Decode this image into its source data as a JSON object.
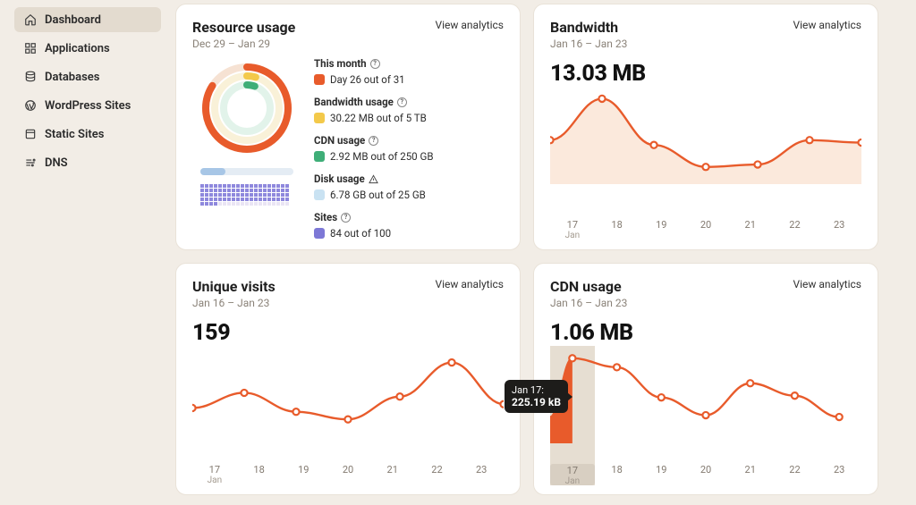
{
  "colors": {
    "accent": "#e85b2b",
    "fill": "#fbe9dc",
    "muted": "#8a8278"
  },
  "sidebar": {
    "items": [
      {
        "label": "Dashboard",
        "icon": "home-icon",
        "active": true
      },
      {
        "label": "Applications",
        "icon": "apps-icon"
      },
      {
        "label": "Databases",
        "icon": "database-icon"
      },
      {
        "label": "WordPress Sites",
        "icon": "wordpress-icon"
      },
      {
        "label": "Static Sites",
        "icon": "static-icon"
      },
      {
        "label": "DNS",
        "icon": "dns-icon"
      }
    ]
  },
  "cards": {
    "resource": {
      "title": "Resource usage",
      "range": "Dec 29 – Jan 29",
      "view": "View analytics",
      "legend": {
        "month": {
          "title": "This month",
          "value": "Day 26 out of 31"
        },
        "bandwidth": {
          "title": "Bandwidth usage",
          "value": "30.22 MB out of 5 TB"
        },
        "cdn": {
          "title": "CDN usage",
          "value": "2.92 MB out of 250 GB"
        },
        "disk": {
          "title": "Disk usage",
          "value": "6.78 GB out of 25 GB"
        },
        "sites": {
          "title": "Sites",
          "value": "84 out of 100"
        }
      }
    },
    "bandwidth": {
      "title": "Bandwidth",
      "range": "Jan 16 – Jan 23",
      "view": "View analytics",
      "metric": "13.03 MB"
    },
    "visits": {
      "title": "Unique visits",
      "range": "Jan 16 – Jan 23",
      "view": "View analytics",
      "metric": "159"
    },
    "cdn": {
      "title": "CDN usage",
      "range": "Jan 16 – Jan 23",
      "view": "View analytics",
      "metric": "1.06 MB",
      "tooltip": {
        "label": "Jan 17:",
        "value": "225.19 kB"
      }
    }
  },
  "chart_data": [
    {
      "type": "donut_multi",
      "id": "resource-rings",
      "title": "Resource usage",
      "series": [
        {
          "name": "This month",
          "value": 26,
          "max": 31,
          "unit": "day",
          "color": "#e85b2b"
        },
        {
          "name": "Bandwidth usage",
          "value": 30.22,
          "max": 5000000,
          "unit": "MB",
          "color": "#f3c94a"
        },
        {
          "name": "CDN usage",
          "value": 2.92,
          "max": 250000,
          "unit": "MB",
          "color": "#3fae78"
        }
      ]
    },
    {
      "type": "bar",
      "id": "disk-usage",
      "title": "Disk usage",
      "categories": [
        "Disk"
      ],
      "values": [
        6.78
      ],
      "ylim": [
        0,
        25
      ],
      "unit": "GB"
    },
    {
      "type": "bar",
      "id": "sites",
      "title": "Sites",
      "categories": [
        "Sites"
      ],
      "values": [
        84
      ],
      "ylim": [
        0,
        100
      ],
      "unit": "sites"
    },
    {
      "type": "line",
      "id": "bandwidth",
      "title": "Bandwidth",
      "xlabel": "Jan",
      "ylabel": "MB",
      "categories": [
        "17",
        "18",
        "19",
        "20",
        "21",
        "22",
        "23"
      ],
      "values": [
        1.6,
        3.3,
        1.4,
        0.5,
        0.6,
        1.6,
        1.5
      ],
      "ylim": [
        0,
        3.5
      ]
    },
    {
      "type": "line",
      "id": "unique-visits",
      "title": "Unique visits",
      "xlabel": "Jan",
      "ylabel": "visits",
      "categories": [
        "17",
        "18",
        "19",
        "20",
        "21",
        "22",
        "23"
      ],
      "values": [
        16,
        24,
        14,
        10,
        22,
        40,
        18
      ],
      "ylim": [
        0,
        45
      ]
    },
    {
      "type": "area",
      "id": "cdn-usage",
      "title": "CDN usage",
      "xlabel": "Jan",
      "ylabel": "kB",
      "categories": [
        "17",
        "18",
        "19",
        "20",
        "21",
        "22",
        "23"
      ],
      "values": [
        225.19,
        200,
        115,
        65,
        155,
        120,
        60
      ],
      "ylim": [
        0,
        240
      ],
      "highlight_index": 0,
      "start_value": 60
    }
  ]
}
